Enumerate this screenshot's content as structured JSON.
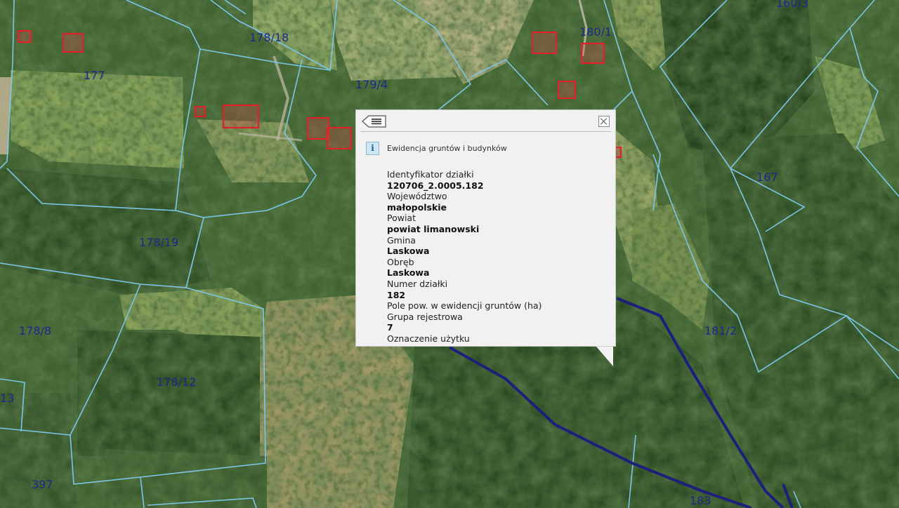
{
  "map": {
    "parcel_labels": [
      {
        "text": "178/18"
      },
      {
        "text": "177"
      },
      {
        "text": "179/4"
      },
      {
        "text": "180/1"
      },
      {
        "text": "160/3"
      },
      {
        "text": "167"
      },
      {
        "text": "178/19"
      },
      {
        "text": "178/8"
      },
      {
        "text": "178/12"
      },
      {
        "text": "181/2"
      },
      {
        "text": "13"
      },
      {
        "text": "397"
      },
      {
        "text": "183"
      }
    ],
    "colors": {
      "parcel_boundary": "#7cc6e8",
      "selected_boundary": "#1d1f7a",
      "building_outline": "#e0202a",
      "label_color": "#1b2a8a"
    }
  },
  "popup": {
    "back_icon": "list-back-icon",
    "close_icon": "close-icon",
    "info_icon_glyph": "i",
    "title": "Ewidencja gruntów i budynków",
    "attributes": [
      {
        "label": "Identyfikator działki",
        "value": "120706_2.0005.182"
      },
      {
        "label": "Województwo",
        "value": "małopolskie"
      },
      {
        "label": "Powiat",
        "value": "powiat limanowski"
      },
      {
        "label": "Gmina",
        "value": "Laskowa"
      },
      {
        "label": "Obręb",
        "value": "Laskowa"
      },
      {
        "label": "Numer działki",
        "value": "182"
      },
      {
        "label": "Pole pow. w ewidencji gruntów (ha)",
        "value": ""
      },
      {
        "label": "Grupa rejestrowa",
        "value": "7"
      },
      {
        "label": "Oznaczenie użytku",
        "value": ""
      }
    ]
  }
}
